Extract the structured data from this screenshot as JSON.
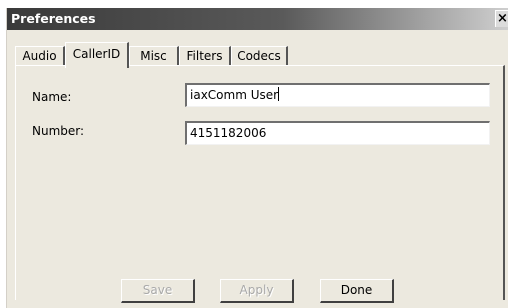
{
  "window": {
    "title": "Preferences",
    "close_glyph": "×"
  },
  "tabs": [
    {
      "label": "Audio",
      "active": false
    },
    {
      "label": "CallerID",
      "active": true
    },
    {
      "label": "Misc",
      "active": false
    },
    {
      "label": "Filters",
      "active": false
    },
    {
      "label": "Codecs",
      "active": false
    }
  ],
  "form": {
    "name_label": "Name:",
    "name_value": "iaxComm User",
    "number_label": "Number:",
    "number_value": "4151182006"
  },
  "buttons": {
    "save": "Save",
    "apply": "Apply",
    "done": "Done"
  }
}
